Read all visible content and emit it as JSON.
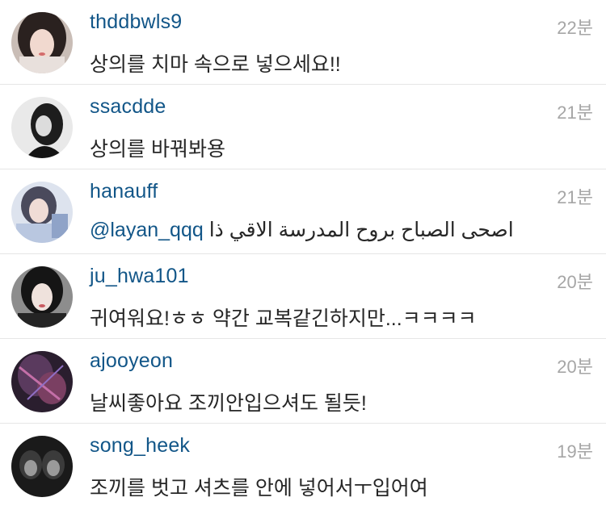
{
  "comments": [
    {
      "username": "thddbwls9",
      "time": "22분",
      "text": "상의를 치마 속으로 넣으세요!!"
    },
    {
      "username": "ssacdde",
      "time": "21분",
      "text": "상의를 바꿔봐용"
    },
    {
      "username": "hanauff",
      "time": "21분",
      "mention": "@layan_qqq",
      "text": "اصحى الصباح بروح المدرسة الاقي ذا"
    },
    {
      "username": "ju_hwa101",
      "time": "20분",
      "text": "귀여워요!ㅎㅎ 약간 교복같긴하지만...ㅋㅋㅋㅋ"
    },
    {
      "username": "ajooyeon",
      "time": "20분",
      "text": "날씨좋아요 조끼안입으셔도 될듯!"
    },
    {
      "username": "song_heek",
      "time": "19분",
      "text": "조끼를 벗고 셔츠를 안에 넣어서ㅜ입어여"
    }
  ],
  "colors": {
    "username": "#125688",
    "text": "#262626",
    "time": "#a6a6a6",
    "divider": "#e6e6e6"
  }
}
